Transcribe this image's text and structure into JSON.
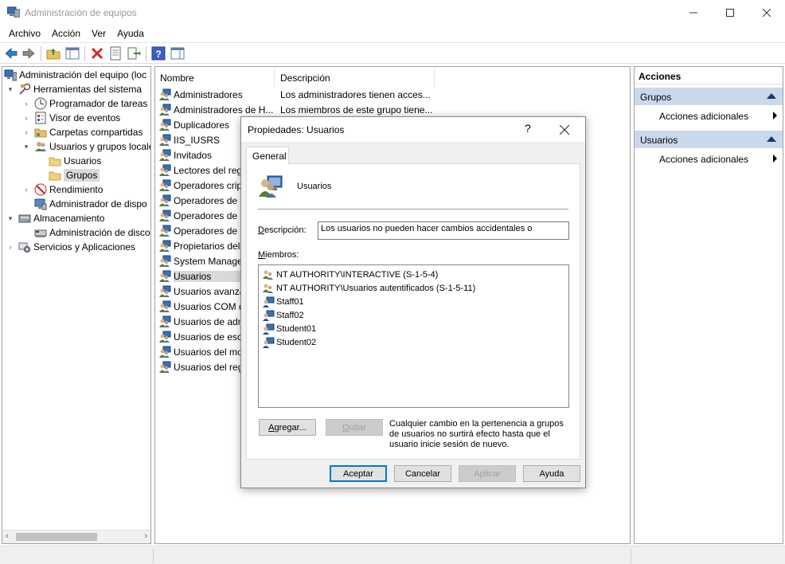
{
  "window": {
    "title": "Administración de equipos"
  },
  "menu": [
    "Archivo",
    "Acción",
    "Ver",
    "Ayuda"
  ],
  "tree": {
    "root": "Administración del equipo (loc",
    "system_tools": "Herramientas del sistema",
    "task_scheduler": "Programador de tareas",
    "event_viewer": "Visor de eventos",
    "shared_folders": "Carpetas compartidas",
    "local_users": "Usuarios y grupos locale",
    "users": "Usuarios",
    "groups": "Grupos",
    "performance": "Rendimiento",
    "device_manager": "Administrador de dispo",
    "storage": "Almacenamiento",
    "disk_management": "Administración de disco",
    "services": "Servicios y Aplicaciones"
  },
  "list": {
    "columns": {
      "name": "Nombre",
      "description": "Descripción"
    },
    "rows": [
      {
        "name": "Administradores",
        "desc": "Los administradores tienen acces..."
      },
      {
        "name": "Administradores de H...",
        "desc": "Los miembros de este grupo tiene..."
      },
      {
        "name": "Duplicadores",
        "desc": ""
      },
      {
        "name": "IIS_IUSRS",
        "desc": ""
      },
      {
        "name": "Invitados",
        "desc": ""
      },
      {
        "name": "Lectores del reg",
        "desc": ""
      },
      {
        "name": "Operadores crip",
        "desc": ""
      },
      {
        "name": "Operadores de a",
        "desc": ""
      },
      {
        "name": "Operadores de c",
        "desc": ""
      },
      {
        "name": "Operadores de c",
        "desc": ""
      },
      {
        "name": "Propietarios del",
        "desc": ""
      },
      {
        "name": "System Manage",
        "desc": ""
      },
      {
        "name": "Usuarios",
        "desc": ""
      },
      {
        "name": "Usuarios avanza",
        "desc": ""
      },
      {
        "name": "Usuarios COM d",
        "desc": ""
      },
      {
        "name": "Usuarios de adm",
        "desc": ""
      },
      {
        "name": "Usuarios de escr",
        "desc": ""
      },
      {
        "name": "Usuarios del mo",
        "desc": ""
      },
      {
        "name": "Usuarios del reg",
        "desc": ""
      }
    ]
  },
  "actions": {
    "header": "Acciones",
    "sections": [
      {
        "title": "Grupos",
        "item": "Acciones adicionales"
      },
      {
        "title": "Usuarios",
        "item": "Acciones adicionales"
      }
    ]
  },
  "dialog": {
    "title": "Propiedades: Usuarios",
    "help": "?",
    "tab": "General",
    "group_name": "Usuarios",
    "description_label": "Descripción:",
    "description_value": "Los usuarios no pueden hacer cambios accidentales o",
    "members_label": "Miembros:",
    "members": [
      "NT AUTHORITY\\INTERACTIVE (S-1-5-4)",
      "NT AUTHORITY\\Usuarios autentificados (S-1-5-11)",
      "Staff01",
      "Staff02",
      "Student01",
      "Student02"
    ],
    "add_button": "Agregar...",
    "remove_button": "Quitar",
    "note": "Cualquier cambio en la pertenencia a grupos de usuarios no surtirá efecto hasta que el usuario inicie sesión de nuevo.",
    "ok": "Aceptar",
    "cancel": "Cancelar",
    "apply": "Aplicar",
    "help_button": "Ayuda"
  }
}
